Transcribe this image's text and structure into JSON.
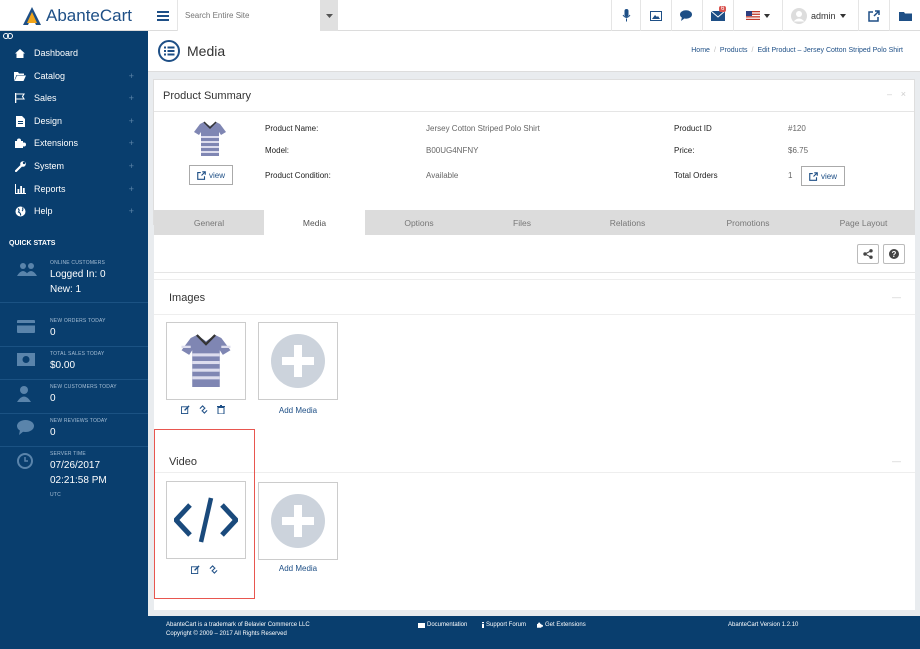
{
  "topbar": {
    "logo_text": "AbanteCart",
    "search_placeholder": "Search Entire Site",
    "mail_badge": "6",
    "user_name": "admin"
  },
  "sidebar": {
    "items": [
      {
        "label": "Dashboard",
        "icon": "home-icon",
        "has_plus": false
      },
      {
        "label": "Catalog",
        "icon": "folder-open-icon",
        "has_plus": true
      },
      {
        "label": "Sales",
        "icon": "flag-icon",
        "has_plus": true
      },
      {
        "label": "Design",
        "icon": "file-icon",
        "has_plus": true
      },
      {
        "label": "Extensions",
        "icon": "puzzle-icon",
        "has_plus": true
      },
      {
        "label": "System",
        "icon": "wrench-icon",
        "has_plus": true
      },
      {
        "label": "Reports",
        "icon": "bar-chart-icon",
        "has_plus": true
      },
      {
        "label": "Help",
        "icon": "globe-icon",
        "has_plus": true
      }
    ],
    "quick_stats_title": "QUICK STATS",
    "stats": {
      "online_label": "ONLINE CUSTOMERS",
      "logged_in": "Logged In: 0",
      "new": "New: 1",
      "orders_label": "NEW ORDERS TODAY",
      "orders_value": "0",
      "sales_label": "TOTAL SALES TODAY",
      "sales_value": "$0.00",
      "customers_label": "NEW CUSTOMERS TODAY",
      "customers_value": "0",
      "reviews_label": "NEW REVIEWS TODAY",
      "reviews_value": "0",
      "time_label": "SERVER TIME",
      "date": "07/26/2017",
      "time": "02:21:58 PM",
      "tz": "UTC"
    }
  },
  "header": {
    "title": "Media",
    "breadcrumb": [
      "Home",
      "Products",
      "Edit  Product – Jersey Cotton Striped Polo Shirt"
    ]
  },
  "summary": {
    "title": "Product Summary",
    "view_label": "view",
    "product_name_label": "Product Name:",
    "product_name": "Jersey Cotton Striped Polo Shirt",
    "model_label": "Model:",
    "model": "B00UG4NFNY",
    "condition_label": "Product Condition:",
    "condition": "Available",
    "id_label": "Product ID",
    "id": "#120",
    "price_label": "Price:",
    "price": "$6.75",
    "orders_label": "Total Orders",
    "orders": "1"
  },
  "tabs": [
    "General",
    "Media",
    "Options",
    "Files",
    "Relations",
    "Promotions",
    "Page Layout"
  ],
  "images_section": {
    "title": "Images",
    "add_label": "Add Media"
  },
  "video_section": {
    "title": "Video",
    "add_label": "Add Media"
  },
  "footer": {
    "left1": "AbanteCart is a trademark of Belavier Commerce LLC",
    "left2": "Copyright © 2009 – 2017 All Rights Reserved",
    "documentation": "Documentation",
    "support": "Support Forum",
    "extensions": "Get Extensions",
    "version": "AbanteCart Version 1.2.10"
  },
  "colors": {
    "sidebar": "#093e6e",
    "accent": "#1e4f86",
    "highlight": "#e8564f"
  }
}
